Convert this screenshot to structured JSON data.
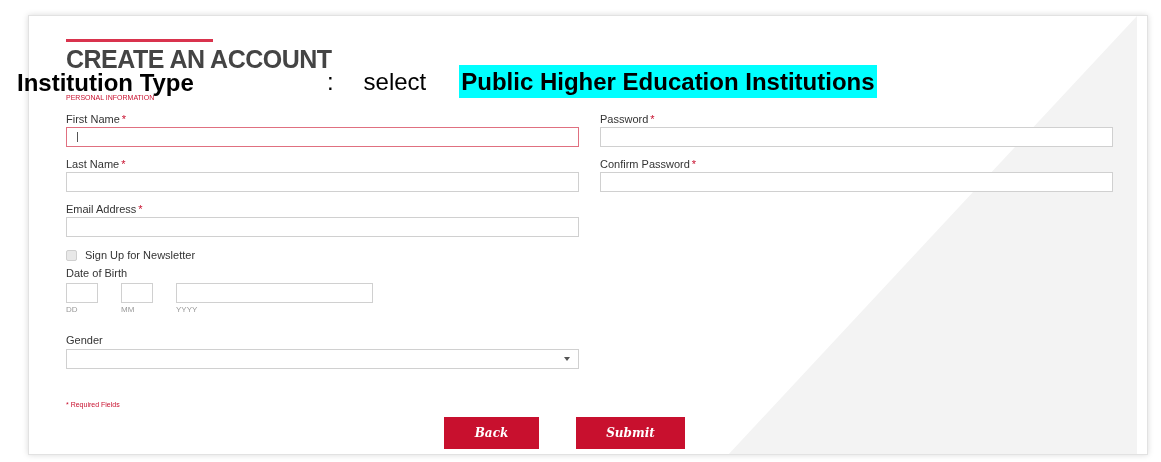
{
  "overlay": {
    "label": "Institution Type",
    "separator": ":",
    "prompt": "select",
    "value": "Public Higher Education Institutions"
  },
  "form": {
    "title": "CREATE AN ACCOUNT",
    "section": "PERSONAL INFORMATION",
    "left_fields": [
      {
        "label": "First Name",
        "mark": "*",
        "focused": true
      },
      {
        "label": "Last Name",
        "mark": "*",
        "focused": false
      },
      {
        "label": "Email Address",
        "mark": "*",
        "focused": false
      }
    ],
    "newsletter": {
      "label": "Sign Up for Newsletter",
      "checked": false
    },
    "birth": {
      "label": "Date of Birth",
      "parts": [
        {
          "caption": "DD"
        },
        {
          "caption": "MM"
        },
        {
          "caption": "YYYY"
        }
      ]
    },
    "gender": {
      "label": "Gender"
    },
    "right_fields": [
      {
        "label": "Password",
        "mark": "*",
        "focused": false
      },
      {
        "label": "Confirm Password",
        "mark": "*",
        "focused": false
      }
    ],
    "note": "* Required Fields",
    "buttons": [
      "Back",
      "Submit"
    ]
  }
}
